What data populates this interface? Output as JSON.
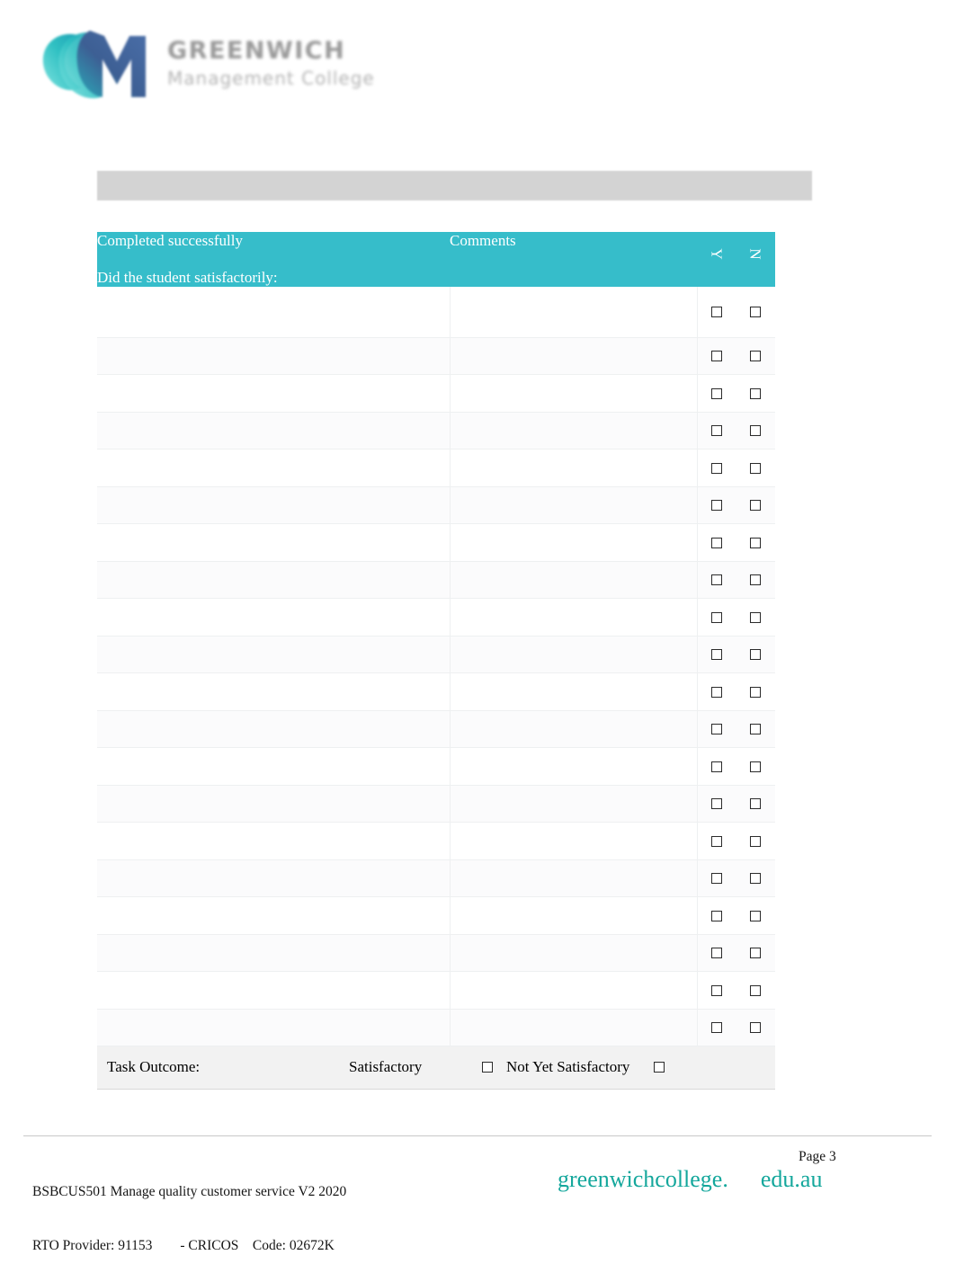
{
  "logo": {
    "mark_name": "greenwich-gm-monogram",
    "wordmark_line1": "GREENWICH",
    "wordmark_line2": "Management College",
    "teal": "#35bcc9",
    "navy": "#3f5b8c"
  },
  "grey_bar": {
    "name": "section-heading-bar",
    "text": "",
    "color": "#d3d3d3"
  },
  "table": {
    "accent_color": "#36bdca",
    "headers": {
      "task_line1": "Completed successfully",
      "task_line2": "Did the student satisfactorily:",
      "comments": "Comments",
      "yes": "Y",
      "no": "N"
    },
    "rows": [
      {
        "task": "",
        "comments": "",
        "yes": false,
        "no": false
      },
      {
        "task": "",
        "comments": "",
        "yes": false,
        "no": false
      },
      {
        "task": "",
        "comments": "",
        "yes": false,
        "no": false
      },
      {
        "task": "",
        "comments": "",
        "yes": false,
        "no": false
      },
      {
        "task": "",
        "comments": "",
        "yes": false,
        "no": false
      },
      {
        "task": "",
        "comments": "",
        "yes": false,
        "no": false
      },
      {
        "task": "",
        "comments": "",
        "yes": false,
        "no": false
      },
      {
        "task": "",
        "comments": "",
        "yes": false,
        "no": false
      },
      {
        "task": "",
        "comments": "",
        "yes": false,
        "no": false
      },
      {
        "task": "",
        "comments": "",
        "yes": false,
        "no": false
      },
      {
        "task": "",
        "comments": "",
        "yes": false,
        "no": false
      },
      {
        "task": "",
        "comments": "",
        "yes": false,
        "no": false
      },
      {
        "task": "",
        "comments": "",
        "yes": false,
        "no": false
      },
      {
        "task": "",
        "comments": "",
        "yes": false,
        "no": false
      },
      {
        "task": "",
        "comments": "",
        "yes": false,
        "no": false
      },
      {
        "task": "",
        "comments": "",
        "yes": false,
        "no": false
      },
      {
        "task": "",
        "comments": "",
        "yes": false,
        "no": false
      },
      {
        "task": "",
        "comments": "",
        "yes": false,
        "no": false
      },
      {
        "task": "",
        "comments": "",
        "yes": false,
        "no": false
      },
      {
        "task": "",
        "comments": "",
        "yes": false,
        "no": false
      }
    ]
  },
  "task_outcome": {
    "label": "Task Outcome:",
    "satisfactory_label": "Satisfactory",
    "satisfactory_checked": false,
    "not_yet_satisfactory_label": "Not Yet Satisfactory",
    "not_yet_satisfactory_checked": false
  },
  "footer": {
    "unit_line": "BSBCUS501 Manage quality customer service V2 2020",
    "provider_line": "RTO Provider: 91153        - CRICOS    Code: 02672K",
    "page_label": "Page 3",
    "brand_name": "greenwichcollege.",
    "brand_domain": "edu.au",
    "brand_color": "#14a79c"
  }
}
